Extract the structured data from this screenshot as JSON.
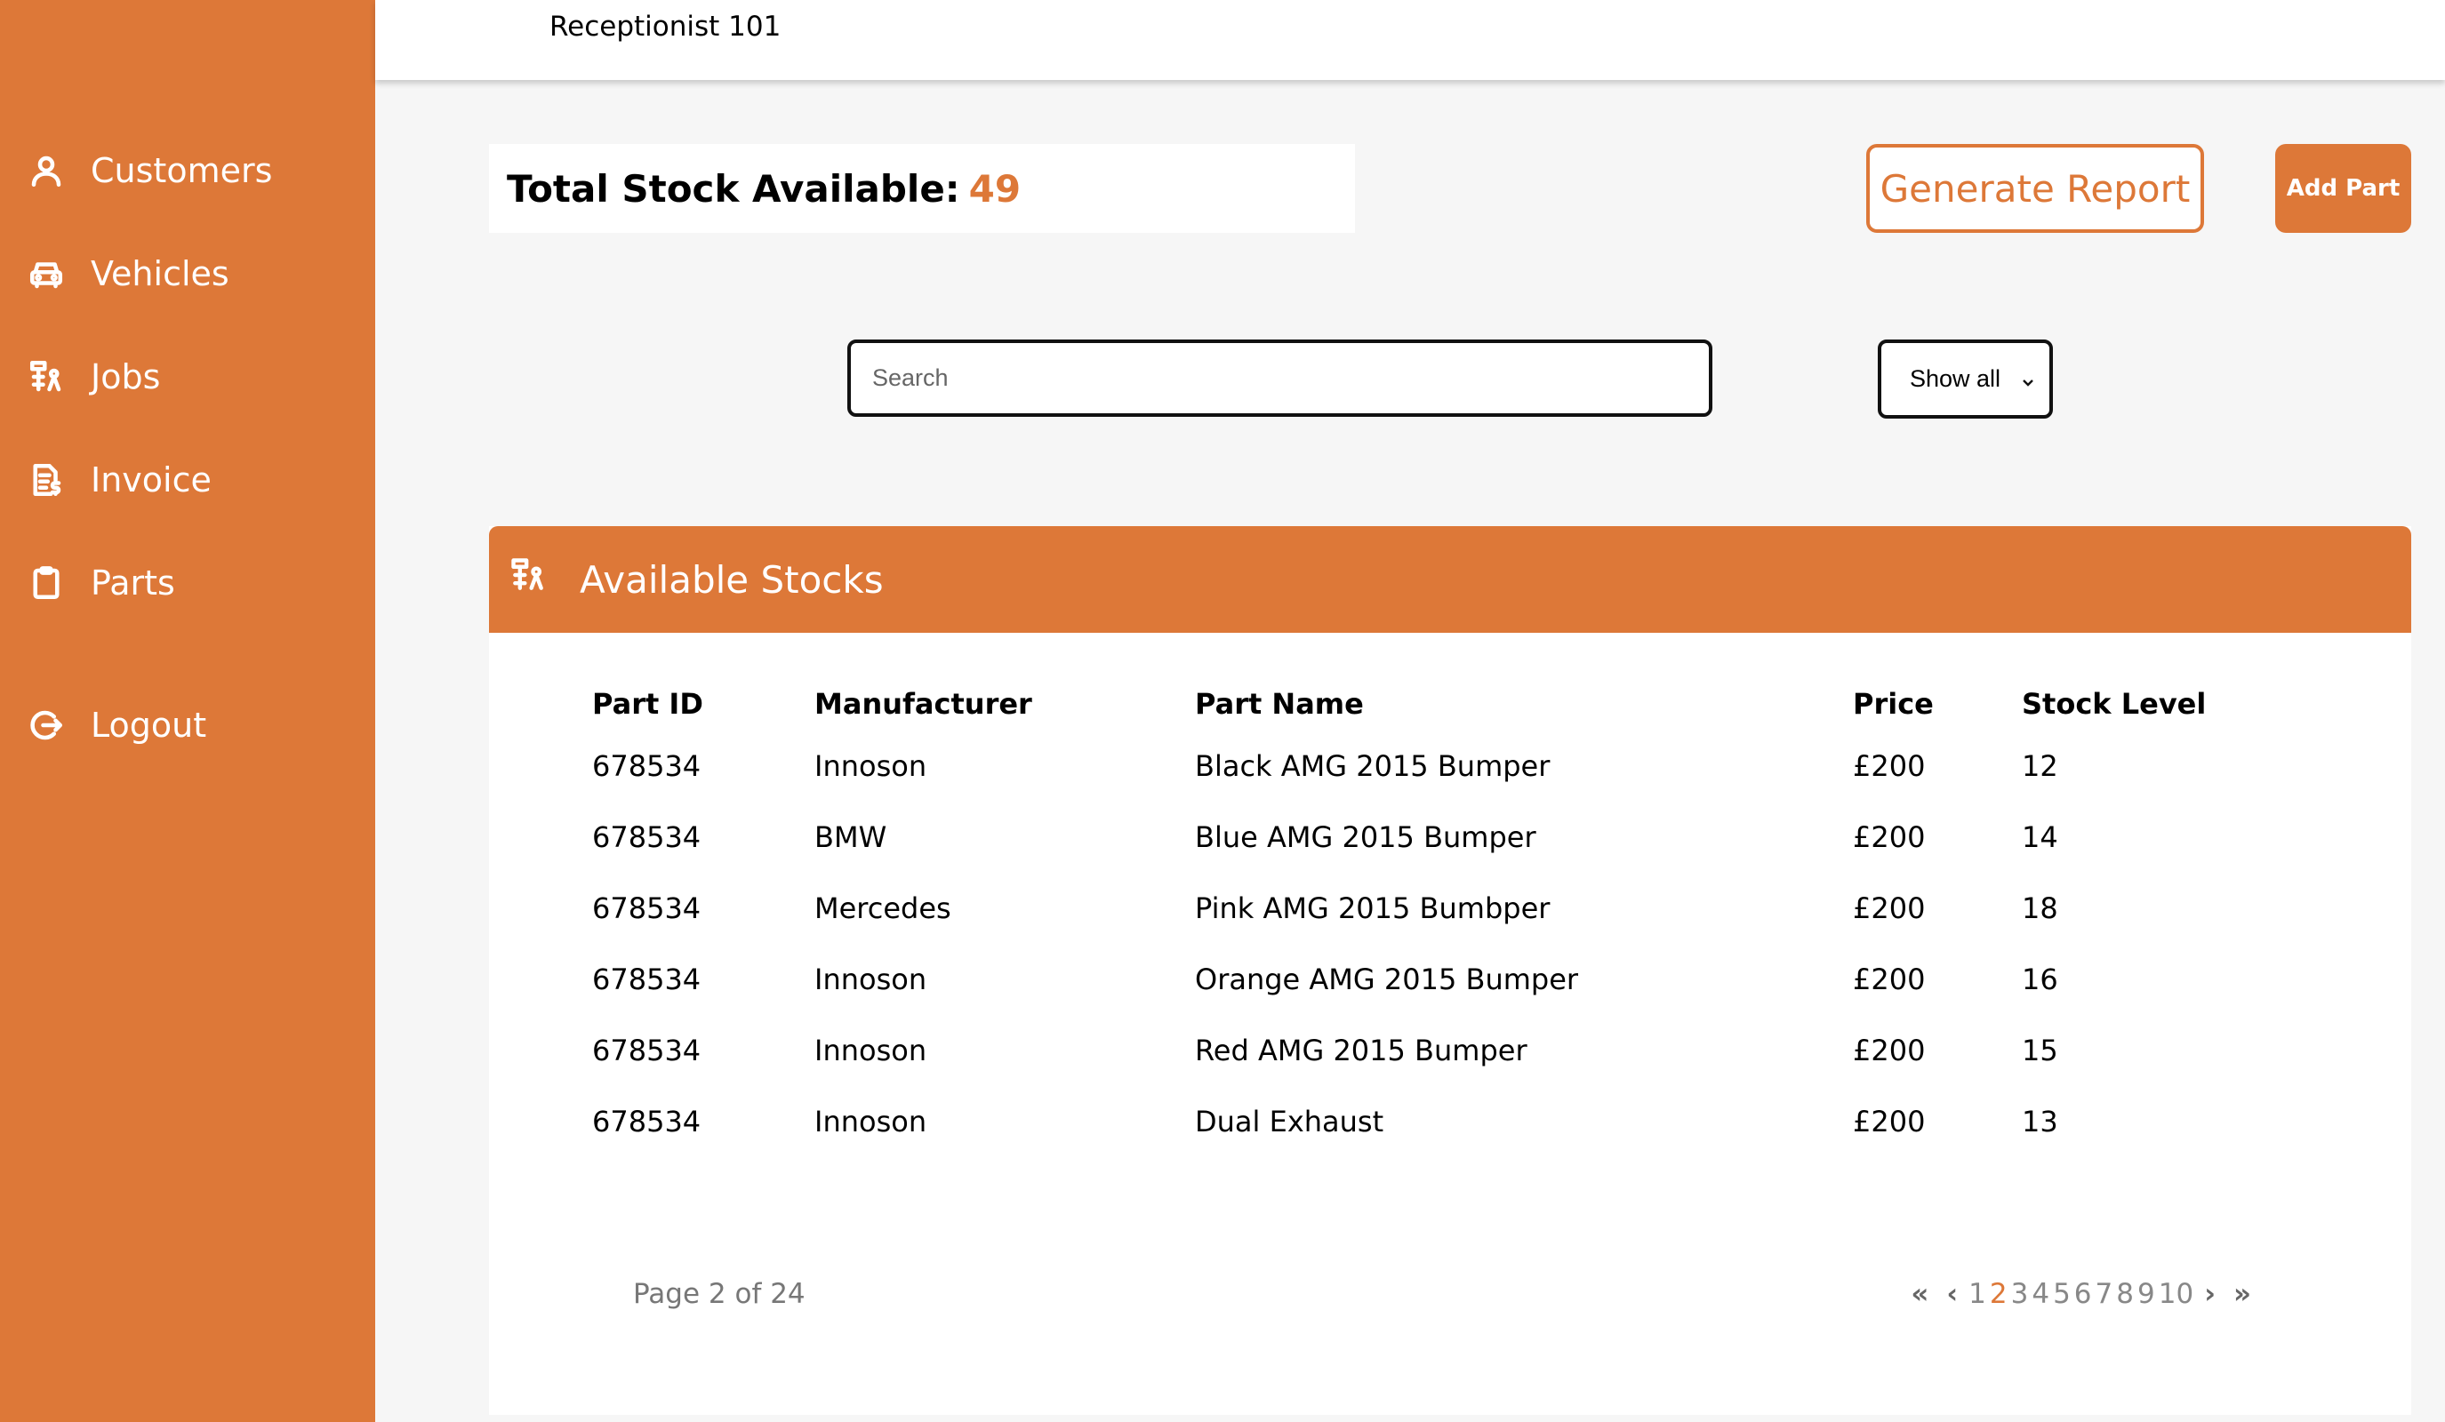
{
  "header": {
    "user": "Receptionist 101"
  },
  "sidebar": {
    "items": [
      {
        "label": "Customers",
        "icon": "user-icon"
      },
      {
        "label": "Vehicles",
        "icon": "car-icon"
      },
      {
        "label": "Jobs",
        "icon": "jobs-icon"
      },
      {
        "label": "Invoice",
        "icon": "invoice-icon"
      },
      {
        "label": "Parts",
        "icon": "clipboard-icon"
      }
    ],
    "logout": {
      "label": "Logout",
      "icon": "logout-icon"
    }
  },
  "summary": {
    "label": "Total Stock Available:",
    "value": "49"
  },
  "actions": {
    "report": "Generate Report",
    "add": "Add Part"
  },
  "search": {
    "placeholder": "Search"
  },
  "filter": {
    "selected": "Show all"
  },
  "panel": {
    "title": "Available Stocks",
    "columns": [
      "Part ID",
      "Manufacturer",
      "Part Name",
      "Price",
      "Stock Level"
    ],
    "rows": [
      [
        "678534",
        "Innoson",
        "Black AMG 2015 Bumper",
        "£200",
        "12"
      ],
      [
        "678534",
        "BMW",
        "Blue AMG 2015 Bumper",
        "£200",
        "14"
      ],
      [
        "678534",
        "Mercedes",
        "Pink AMG 2015 Bumbper",
        "£200",
        "18"
      ],
      [
        "678534",
        "Innoson",
        "Orange AMG 2015 Bumper",
        "£200",
        "16"
      ],
      [
        "678534",
        "Innoson",
        "Red AMG 2015 Bumper",
        "£200",
        "15"
      ],
      [
        "678534",
        "Innoson",
        "Dual Exhaust",
        "£200",
        "13"
      ]
    ]
  },
  "pagination": {
    "info": "Page 2 of 24",
    "first": "«",
    "prev": "‹",
    "next": "›",
    "last": "»",
    "pages": [
      "1",
      "2",
      "3",
      "4",
      "5",
      "6",
      "7",
      "8",
      "9",
      "10"
    ],
    "current": "2"
  },
  "colors": {
    "accent": "#dd7838",
    "background": "#f6f6f6"
  }
}
